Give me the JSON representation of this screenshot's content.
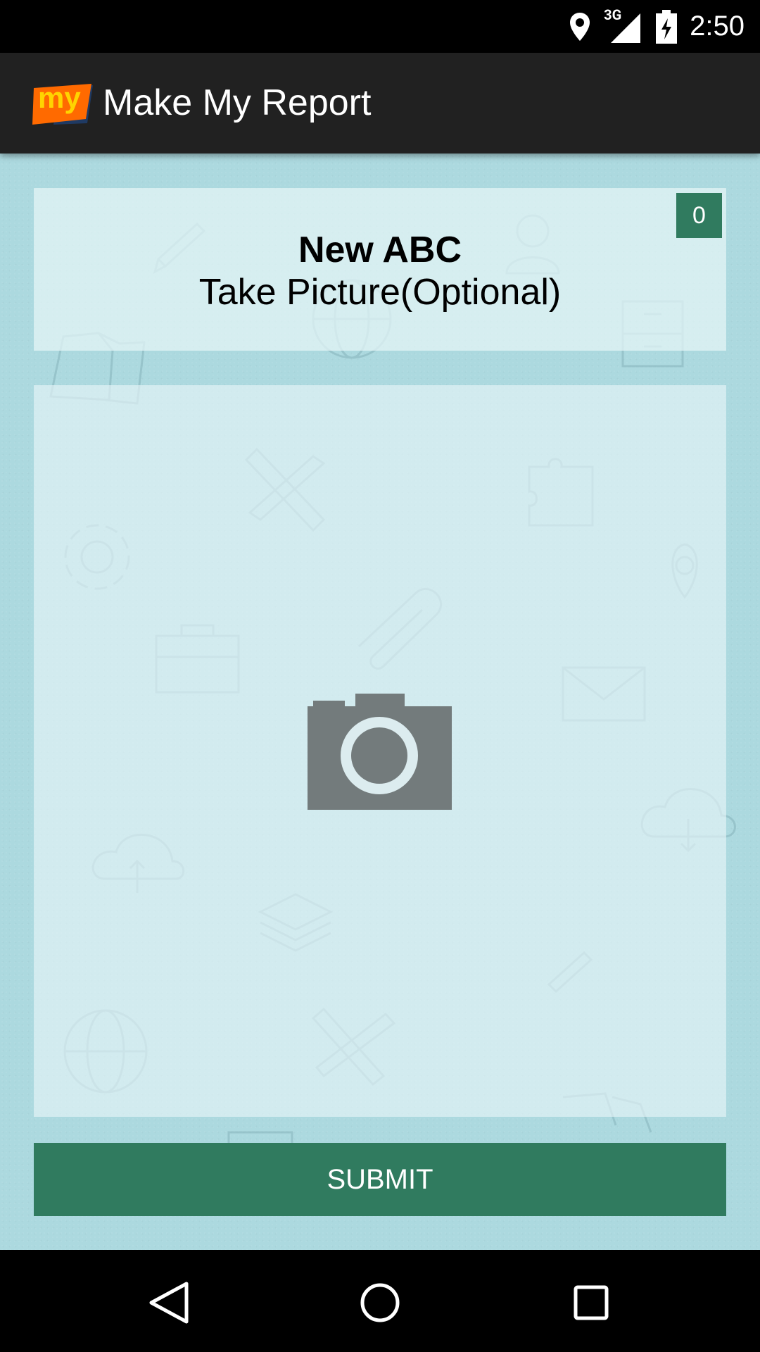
{
  "status_bar": {
    "time": "2:50",
    "network": "3G",
    "icons": [
      "location-icon",
      "signal-icon",
      "battery-charging-icon"
    ]
  },
  "app_bar": {
    "logo_text": "my",
    "title": "Make My Report"
  },
  "report_card": {
    "title": "New ABC",
    "subtitle": "Take Picture(Optional)",
    "photo_count": "0"
  },
  "photo_area": {
    "icon": "camera-icon"
  },
  "actions": {
    "submit_label": "SUBMIT"
  },
  "nav_bar": {
    "icons": [
      "back-icon",
      "home-icon",
      "recents-icon"
    ]
  },
  "colors": {
    "accent_green": "#307b5f",
    "background_teal": "#acd9df",
    "app_bar": "#212121",
    "logo_orange": "#ff6a00"
  }
}
